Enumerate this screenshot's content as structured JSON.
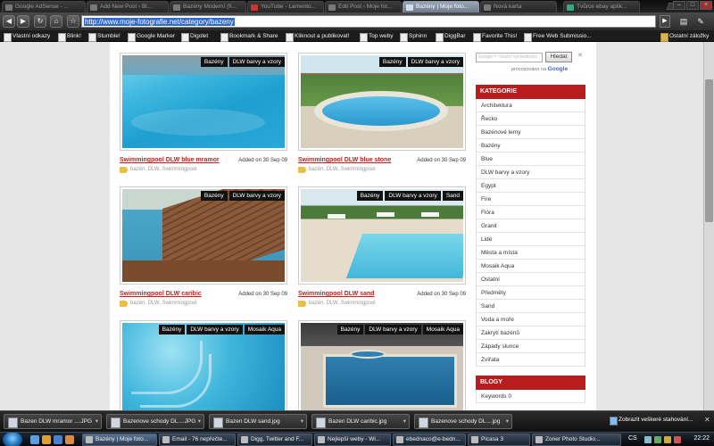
{
  "browser": {
    "tabs": [
      {
        "label": "Google AdSense - ..."
      },
      {
        "label": "Add New Post ‹ Bl..."
      },
      {
        "label": "Bazény Moderní (fi..."
      },
      {
        "label": "YouTube - Lamento..."
      },
      {
        "label": "Edit Post ‹ Moje fot..."
      },
      {
        "label": "Bazény | Moje foto..."
      },
      {
        "label": "Nová karta"
      },
      {
        "label": "Tvůrce ebay aplik..."
      }
    ],
    "active_tab_index": 5,
    "url": "http://www.moje-fotografie.net/category/bazeny",
    "bookmarks": [
      {
        "label": "Vlastní odkazy"
      },
      {
        "label": "Blink!"
      },
      {
        "label": "Stumble!"
      },
      {
        "label": "Google Marker"
      },
      {
        "label": "Digolet"
      },
      {
        "label": "Bookmark & Share"
      },
      {
        "label": "Kliknout a publikovat!"
      },
      {
        "label": "Top weby"
      },
      {
        "label": "Sphinn"
      },
      {
        "label": "DiggBar"
      },
      {
        "label": "Favorite This!"
      },
      {
        "label": "Free Web Submissio..."
      }
    ],
    "other_bookmarks": "Ostatní záložky"
  },
  "posts": [
    {
      "title": "Swimmingpool DLW blue mramor",
      "date": "Added on 30 Sep 09",
      "cats": "bazén, DLW, Swimmingpool",
      "tags": [
        "Bazény",
        "DLW barvy a vzory"
      ]
    },
    {
      "title": "Swimmingpool DLW blue stone",
      "date": "Added on 30 Sep 09",
      "cats": "bazén, DLW, Swimmingpool",
      "tags": [
        "Bazény",
        "DLW barvy a vzory"
      ]
    },
    {
      "title": "Swimmingpool DLW caribic",
      "date": "Added on 30 Sep 09",
      "cats": "bazén, DLW, Swimmingpool",
      "tags": [
        "Bazény",
        "DLW barvy a vzory"
      ]
    },
    {
      "title": "Swimmingpool DLW sand",
      "date": "Added on 30 Sep 09",
      "cats": "bazén, DLW, Swimmingpool",
      "tags": [
        "Bazény",
        "DLW barvy a vzory",
        "Sand"
      ]
    },
    {
      "title": "",
      "date": "",
      "cats": "",
      "tags": [
        "Bazény",
        "DLW barvy a vzory",
        "Mosaik Aqua"
      ]
    },
    {
      "title": "",
      "date": "",
      "cats": "",
      "tags": [
        "Bazény",
        "DLW barvy a vzory",
        "Mosaik Aqua"
      ]
    }
  ],
  "sidebar": {
    "search_placeholder": "Google™ Vlastní vyhledávání",
    "search_button": "Hledat",
    "powered_by": "provozováno na",
    "powered_brand": "Google",
    "categories_title": "KATEGORIE",
    "categories": [
      "Architektura",
      "Řecko",
      "Bazénové lemy",
      "Bazény",
      "Blue",
      "DLW barvy a vzory",
      "Egypt",
      "Fire",
      "Flóra",
      "Granit",
      "Lidé",
      "Města a místa",
      "Mosaik Aqua",
      "Ostatní",
      "Předměty",
      "Sand",
      "Voda a moře",
      "Zakrytí bazénů",
      "Západy slunce",
      "Zvířata"
    ],
    "blogy_title": "BLOGY",
    "blogy": [
      "Keywords 0"
    ]
  },
  "downloads": {
    "items": [
      "Bazen DLW mramor ....JPG",
      "Bazenove schody DL....JPG",
      "Bazen DLW sand.jpg",
      "Bazen DLW caribic.jpg",
      "Bazenove schody DL....jpg"
    ],
    "show_all": "Zobrazit veškeré stahování..."
  },
  "taskbar": {
    "tasks": [
      "Bazény | Moje foto...",
      "Email - 76 nepřečte...",
      "Digg, Twitter and F...",
      "Nejlepší weby - Wi...",
      "ebednaco@e-bedn...",
      "Picasa 3",
      "Zoner Photo Studio..."
    ],
    "lang": "CS",
    "clock": "22:22"
  },
  "colors": {
    "accent_red": "#b81c1c",
    "link_red": "#c02020"
  }
}
